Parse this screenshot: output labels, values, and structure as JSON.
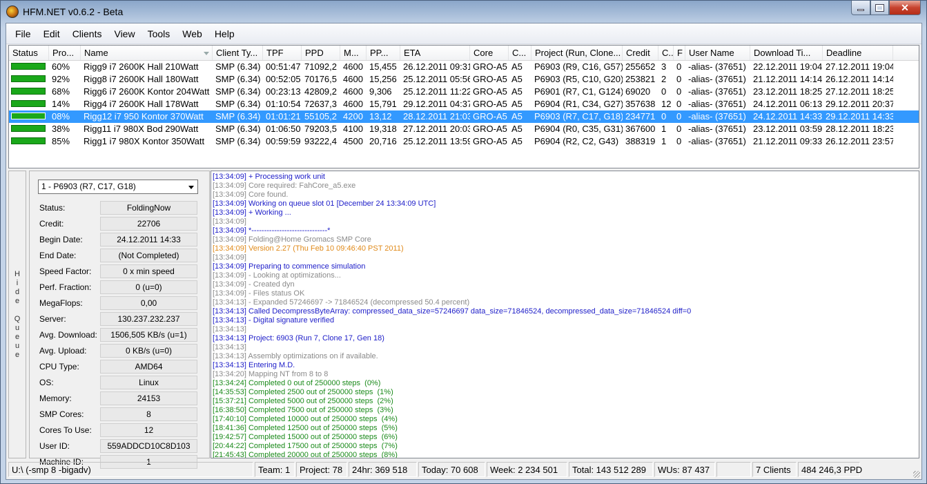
{
  "window": {
    "title": "HFM.NET v0.6.2 - Beta"
  },
  "menu": [
    "File",
    "Edit",
    "Clients",
    "View",
    "Tools",
    "Web",
    "Help"
  ],
  "columns": [
    "Status",
    "Pro...",
    "Name",
    "Client Ty...",
    "TPF",
    "PPD",
    "M...",
    "PP...",
    "ETA",
    "Core",
    "C...",
    "Project (Run, Clone...",
    "Credit",
    "C...",
    "F",
    "User Name",
    "Download Ti...",
    "Deadline"
  ],
  "rows": [
    [
      "60%",
      "Rigg9  i7 2600K Hall 210Watt",
      "SMP (6.34)",
      "00:51:47",
      "71092,2",
      "4600",
      "15,455",
      "26.12.2011 09:31",
      "GRO-A5",
      "A5",
      "P6903 (R9, C16, G57)",
      "255652",
      "3",
      "0",
      "-alias- (37651)",
      "22.12.2011 19:04",
      "27.12.2011 19:04"
    ],
    [
      "92%",
      "Rigg8 i7 2600K Hall 180Watt",
      "SMP (6.34)",
      "00:52:05",
      "70176,5",
      "4600",
      "15,256",
      "25.12.2011 05:56",
      "GRO-A5",
      "A5",
      "P6903 (R5, C10, G20)",
      "253821",
      "2",
      "0",
      "-alias- (37651)",
      "21.12.2011 14:14",
      "26.12.2011 14:14"
    ],
    [
      "68%",
      "Rigg6 i7 2600K Kontor 204Watt",
      "SMP (6.34)",
      "00:23:13",
      "42809,2",
      "4600",
      "9,306",
      "25.12.2011 11:22",
      "GRO-A5",
      "A5",
      "P6901 (R7, C1, G124)",
      "69020",
      "0",
      "0",
      "-alias- (37651)",
      "23.12.2011 18:25",
      "27.12.2011 18:25"
    ],
    [
      "14%",
      "Rigg4 i7 2600K Hall 178Watt",
      "SMP (6.34)",
      "01:10:54",
      "72637,3",
      "4600",
      "15,791",
      "29.12.2011 04:37",
      "GRO-A5",
      "A5",
      "P6904 (R1, C34, G27)",
      "357638",
      "12",
      "0",
      "-alias- (37651)",
      "24.12.2011 06:13",
      "29.12.2011 20:37"
    ],
    [
      "08%",
      "Rigg12 i7 950 Kontor 370Watt",
      "SMP (6.34)",
      "01:01:21",
      "55105,2",
      "4200",
      "13,12",
      "28.12.2011 21:03",
      "GRO-A5",
      "A5",
      "P6903 (R7, C17, G18)",
      "234771",
      "0",
      "0",
      "-alias- (37651)",
      "24.12.2011 14:33",
      "29.12.2011 14:33"
    ],
    [
      "38%",
      "Rigg11 i7 980X Bod 290Watt",
      "SMP (6.34)",
      "01:06:50",
      "79203,5",
      "4100",
      "19,318",
      "27.12.2011 20:03",
      "GRO-A5",
      "A5",
      "P6904 (R0, C35, G31)",
      "367600",
      "1",
      "0",
      "-alias- (37651)",
      "23.12.2011 03:59",
      "28.12.2011 18:23"
    ],
    [
      "85%",
      "Rigg1 i7 980X  Kontor 350Watt",
      "SMP (6.34)",
      "00:59:59",
      "93222,4",
      "4500",
      "20,716",
      "25.12.2011 13:59",
      "GRO-A5",
      "A5",
      "P6904 (R2, C2, G43)",
      "388319",
      "1",
      "0",
      "-alias- (37651)",
      "21.12.2011 09:33",
      "26.12.2011 23:57"
    ]
  ],
  "selected_row": 4,
  "hide_queue_label": "Hide Queue",
  "queue": {
    "selected": "1 - P6903 (R7, C17, G18)",
    "props": [
      [
        "Status:",
        "FoldingNow"
      ],
      [
        "Credit:",
        "22706"
      ],
      [
        "Begin Date:",
        "24.12.2011 14:33"
      ],
      [
        "End Date:",
        "(Not Completed)"
      ],
      [
        "Speed Factor:",
        "0 x min speed"
      ],
      [
        "Perf. Fraction:",
        "0 (u=0)"
      ],
      [
        "MegaFlops:",
        "0,00"
      ],
      [
        "Server:",
        "130.237.232.237"
      ],
      [
        "Avg. Download:",
        "1506,505 KB/s (u=1)"
      ],
      [
        "Avg. Upload:",
        "0 KB/s (u=0)"
      ],
      [
        "CPU Type:",
        "AMD64"
      ],
      [
        "OS:",
        "Linux"
      ],
      [
        "Memory:",
        "24153"
      ],
      [
        "SMP Cores:",
        "8"
      ],
      [
        "Cores To Use:",
        "12"
      ],
      [
        "User ID:",
        "559ADDCD10C8D103"
      ],
      [
        "Machine ID:",
        "1"
      ]
    ]
  },
  "log": [
    [
      "[13:34:09] + Processing work unit",
      "#1c1cc8"
    ],
    [
      "[13:34:09] Core required: FahCore_a5.exe",
      "#8a8a8a"
    ],
    [
      "[13:34:09] Core found.",
      "#8a8a8a"
    ],
    [
      "[13:34:09] Working on queue slot 01 [December 24 13:34:09 UTC]",
      "#1c1cc8"
    ],
    [
      "[13:34:09] + Working ...",
      "#1c1cc8"
    ],
    [
      "[13:34:09]",
      "#8a8a8a"
    ],
    [
      "[13:34:09] *------------------------------*",
      "#1c1cc8"
    ],
    [
      "[13:34:09] Folding@Home Gromacs SMP Core",
      "#8a8a8a"
    ],
    [
      "[13:34:09] Version 2.27 (Thu Feb 10 09:46:40 PST 2011)",
      "#e08a1a"
    ],
    [
      "[13:34:09]",
      "#8a8a8a"
    ],
    [
      "[13:34:09] Preparing to commence simulation",
      "#1c1cc8"
    ],
    [
      "[13:34:09] - Looking at optimizations...",
      "#8a8a8a"
    ],
    [
      "[13:34:09] - Created dyn",
      "#8a8a8a"
    ],
    [
      "[13:34:09] - Files status OK",
      "#8a8a8a"
    ],
    [
      "[13:34:13] - Expanded 57246697 -> 71846524 (decompressed 50.4 percent)",
      "#8a8a8a"
    ],
    [
      "[13:34:13] Called DecompressByteArray: compressed_data_size=57246697 data_size=71846524, decompressed_data_size=71846524 diff=0",
      "#1c1cc8"
    ],
    [
      "[13:34:13] - Digital signature verified",
      "#1c1cc8"
    ],
    [
      "[13:34:13]",
      "#8a8a8a"
    ],
    [
      "[13:34:13] Project: 6903 (Run 7, Clone 17, Gen 18)",
      "#1c1cc8"
    ],
    [
      "[13:34:13]",
      "#8a8a8a"
    ],
    [
      "[13:34:13] Assembly optimizations on if available.",
      "#8a8a8a"
    ],
    [
      "[13:34:13] Entering M.D.",
      "#1c1cc8"
    ],
    [
      "[13:34:20] Mapping NT from 8 to 8",
      "#8a8a8a"
    ],
    [
      "[13:34:24] Completed 0 out of 250000 steps  (0%)",
      "#1a8a1a"
    ],
    [
      "[14:35:53] Completed 2500 out of 250000 steps  (1%)",
      "#1a8a1a"
    ],
    [
      "[15:37:21] Completed 5000 out of 250000 steps  (2%)",
      "#1a8a1a"
    ],
    [
      "[16:38:50] Completed 7500 out of 250000 steps  (3%)",
      "#1a8a1a"
    ],
    [
      "[17:40:10] Completed 10000 out of 250000 steps  (4%)",
      "#1a8a1a"
    ],
    [
      "[18:41:36] Completed 12500 out of 250000 steps  (5%)",
      "#1a8a1a"
    ],
    [
      "[19:42:57] Completed 15000 out of 250000 steps  (6%)",
      "#1a8a1a"
    ],
    [
      "[20:44:22] Completed 17500 out of 250000 steps  (7%)",
      "#1a8a1a"
    ],
    [
      "[21:45:43] Completed 20000 out of 250000 steps  (8%)",
      "#1a8a1a"
    ]
  ],
  "statusbar": [
    "U:\\ (-smp 8 -bigadv)",
    "Team: 1",
    "Project: 78",
    "24hr: 369 518",
    "Today: 70 608",
    "Week: 2 234 501",
    "Total: 143 512 289",
    "WUs: 87 437",
    "",
    "7 Clients",
    "484 246,3 PPD"
  ]
}
